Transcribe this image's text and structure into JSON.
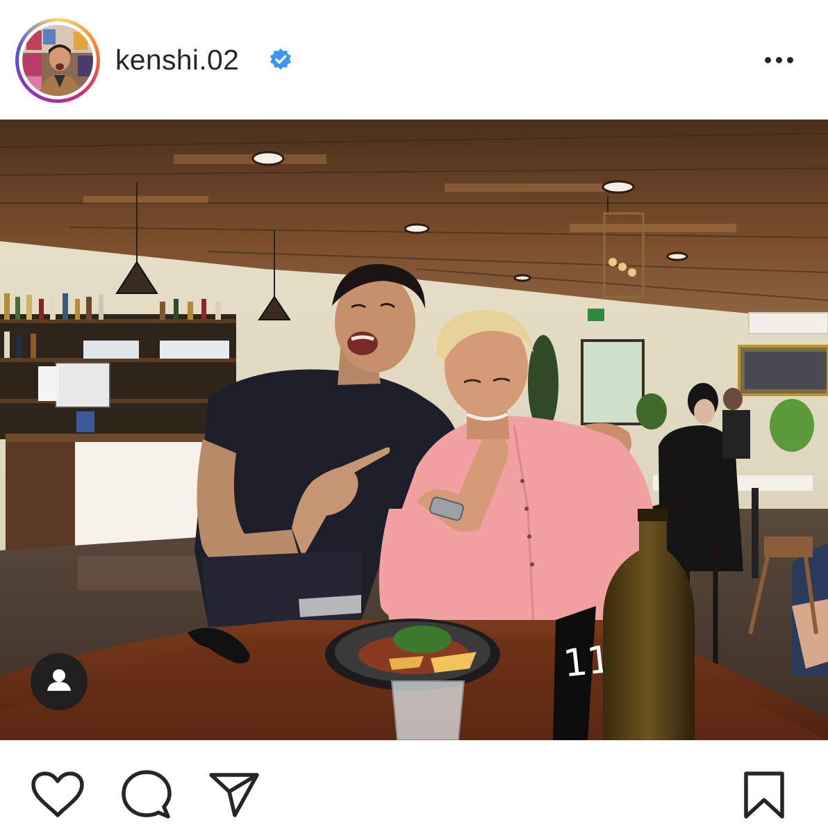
{
  "post": {
    "username": "kenshi.02",
    "verified": true,
    "photo": {
      "table_number": "11"
    }
  },
  "icons": {
    "verified": "verified-badge-icon",
    "more": "more-options-icon",
    "tag": "user-tag-icon",
    "like": "heart-icon",
    "comment": "comment-bubble-icon",
    "share": "paper-plane-icon",
    "save": "bookmark-icon"
  },
  "colors": {
    "verified_blue": "#3897f0",
    "text": "#262626",
    "ring_gradient": [
      "#feda75",
      "#fa7e1e",
      "#d62976",
      "#962fbf",
      "#4f5bd5"
    ]
  }
}
